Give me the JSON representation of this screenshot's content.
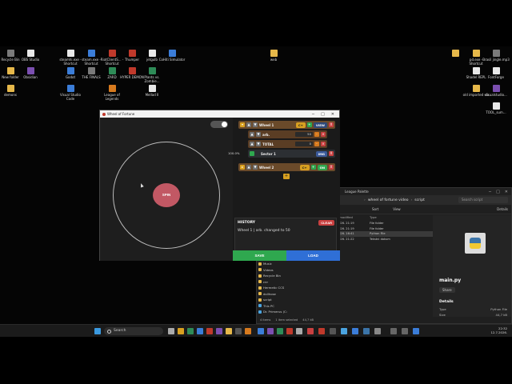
{
  "desktop": {
    "icons": [
      {
        "label": "Recycle Bin",
        "color": "gray"
      },
      {
        "label": "OBS Studio",
        "color": "white"
      },
      {
        "label": "steamhi.exe - Shortcut",
        "color": "white"
      },
      {
        "label": "steam.exe - Shortcut",
        "color": "blue"
      },
      {
        "label": "RiotClientS... - Shortcut",
        "color": "red"
      },
      {
        "label": "Thumper",
        "color": "red"
      },
      {
        "label": "jetgulb",
        "color": "white"
      },
      {
        "label": "CoHiti Simulator",
        "color": "blue"
      },
      {
        "label": "New folder",
        "color": "folder"
      },
      {
        "label": "Obsidian",
        "color": "purple"
      },
      {
        "label": "Godot",
        "color": "blue"
      },
      {
        "label": "THE FINALS",
        "color": "gray"
      },
      {
        "label": "ZARD",
        "color": "green"
      },
      {
        "label": "HYPER DEMON",
        "color": "red"
      },
      {
        "label": "Plants vs. Zombie...",
        "color": "green"
      },
      {
        "label": "demons",
        "color": "folder"
      },
      {
        "label": "Visual Studio Code",
        "color": "blue"
      },
      {
        "label": "League of Legends",
        "color": "orange"
      },
      {
        "label": "Mellad II",
        "color": "white"
      },
      {
        "label": "web",
        "color": "folder"
      },
      {
        "label": "pd.exe - Shortcut",
        "color": "folder"
      },
      {
        "label": "Brasil jingle.mp3",
        "color": "gray"
      },
      {
        "label": "Shadel REPL",
        "color": "white"
      },
      {
        "label": "FontForge",
        "color": "white"
      },
      {
        "label": "old imported sfx",
        "color": "folder"
      },
      {
        "label": "visualstudio...",
        "color": "purple"
      },
      {
        "label": "TOOL_sum...",
        "color": "white"
      }
    ]
  },
  "explorer": {
    "tab": "League Palette",
    "breadcrumb": [
      "wheel of fortune video",
      "script"
    ],
    "search_placeholder": "Search script",
    "toolbar": {
      "sort": "Sort",
      "view": "View",
      "details": "Details"
    },
    "columns": {
      "name": "",
      "date": "Date modified",
      "type": "Type"
    },
    "rows": [
      {
        "date": "6.7.2026. 21:19",
        "type": "File folder",
        "selected": false
      },
      {
        "date": "6.7.2026. 21:19",
        "type": "File folder",
        "selected": false
      },
      {
        "date": "6.7.2026. 16:41",
        "type": "Python File",
        "selected": true
      },
      {
        "date": "6.7.2026. 21:22",
        "type": "Tekstni dokum",
        "selected": false
      }
    ],
    "nav": [
      {
        "label": "Music",
        "pc": false
      },
      {
        "label": "Videos",
        "pc": false
      },
      {
        "label": "Recycle Bin",
        "pc": false
      },
      {
        "label": "rrrr",
        "pc": false
      },
      {
        "label": "Hermetic CCS",
        "pc": false
      },
      {
        "label": "dollhose",
        "pc": false
      },
      {
        "label": "script",
        "pc": false
      },
      {
        "label": "This PC",
        "pc": true
      },
      {
        "label": "Dr. Primerus (C:",
        "pc": true
      }
    ],
    "preview": {
      "filename": "main.py",
      "share": "Share",
      "details_title": "Details",
      "details": [
        {
          "key": "Type",
          "value": "Python File"
        },
        {
          "key": "Size",
          "value": "44,7 kB"
        }
      ]
    },
    "status": {
      "items": "4 items",
      "selected": "1 item selected",
      "size": "44,7 kB"
    }
  },
  "wof": {
    "title": "Wheel of Fortune",
    "spin_label": "SPIN",
    "tree": {
      "wheel1": {
        "label": "Wheel 1",
        "mult": "C+",
        "add": "+",
        "view": "VIEW",
        "delete": "X"
      },
      "arb": {
        "label": "arb.",
        "value": "50"
      },
      "total": {
        "label": "TOTAL",
        "value": "0"
      },
      "sector1": {
        "pct": "100.0%",
        "label": "Sector 1",
        "img": "IMG",
        "delete": "X"
      },
      "wheel2": {
        "label": "Wheel 2",
        "mult": "C+",
        "add": "+",
        "on": "ON",
        "delete": "X"
      },
      "add_wheel": "+"
    },
    "history": {
      "title": "HISTORY",
      "clear": "CLEAR",
      "entries": [
        "Wheel 1 | arb. changed to 50"
      ]
    },
    "save_label": "SAVE",
    "load_label": "LOAD"
  },
  "taskbar": {
    "search": "Search",
    "time": "22:32",
    "date": "12.7.2026."
  }
}
